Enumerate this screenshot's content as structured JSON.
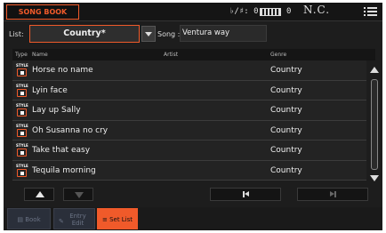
{
  "header": {
    "title": "SONG BOOK",
    "key_label": "♭/♯: 0",
    "meter_value": "0",
    "chord": "N.C."
  },
  "filters": {
    "list_label": "List:",
    "list_value": "Country*",
    "song_label": "Song :",
    "song_value": "Ventura way"
  },
  "table": {
    "columns": [
      "Type",
      "Name",
      "Artist",
      "Genre"
    ],
    "rows": [
      {
        "type": "STYLE",
        "name": "Horse no name",
        "artist": "",
        "genre": "Country"
      },
      {
        "type": "STYLE",
        "name": "Lyin face",
        "artist": "",
        "genre": "Country"
      },
      {
        "type": "STYLE",
        "name": "Lay up Sally",
        "artist": "",
        "genre": "Country"
      },
      {
        "type": "STYLE",
        "name": "Oh Susanna no cry",
        "artist": "",
        "genre": "Country"
      },
      {
        "type": "STYLE",
        "name": "Take that easy",
        "artist": "",
        "genre": "Country"
      },
      {
        "type": "STYLE",
        "name": "Tequila morning",
        "artist": "",
        "genre": "Country"
      }
    ]
  },
  "tabs": [
    {
      "label": "Book",
      "icon": "list-icon",
      "active": false
    },
    {
      "label": "Entry\nEdit",
      "icon": "pencil-icon",
      "active": false
    },
    {
      "label": "Set List",
      "icon": "list-icon",
      "active": true
    }
  ],
  "colors": {
    "accent": "#f05a2a",
    "panel": "#1d1d1d",
    "header": "#151515"
  }
}
